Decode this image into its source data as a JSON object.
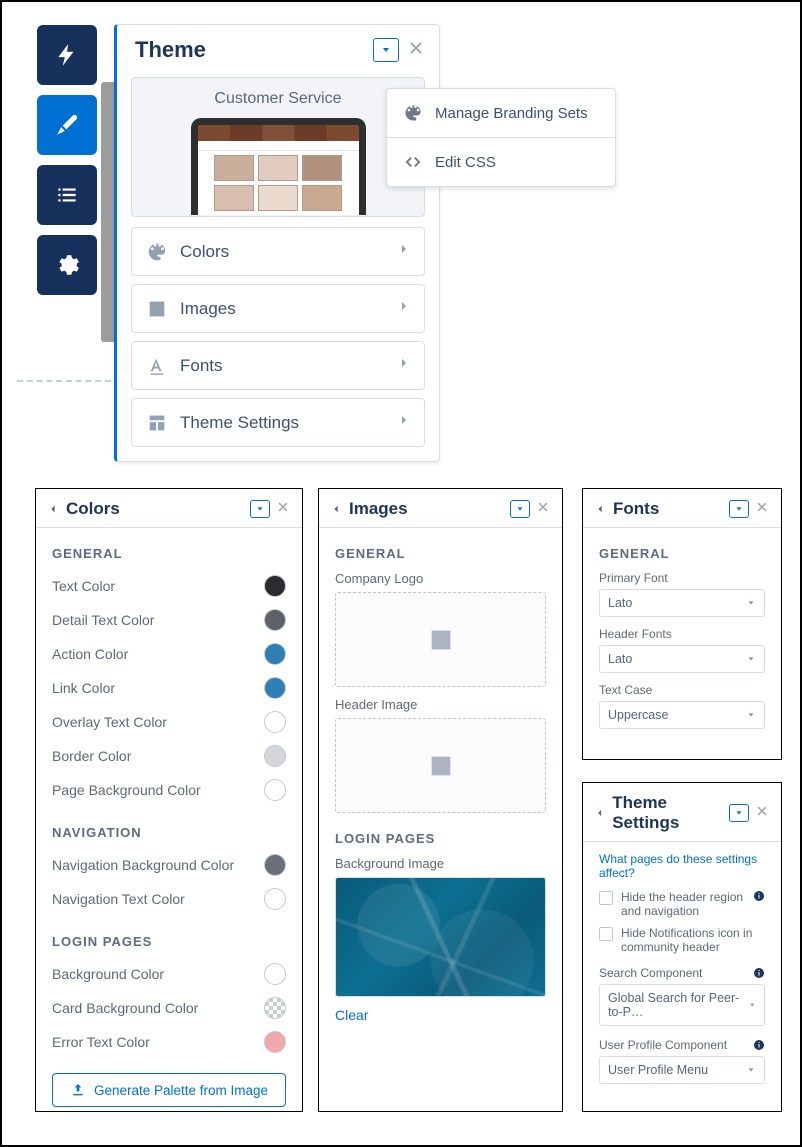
{
  "theme": {
    "title": "Theme",
    "previewTitle": "Customer Service",
    "items": [
      {
        "id": "colors",
        "label": "Colors"
      },
      {
        "id": "images",
        "label": "Images"
      },
      {
        "id": "fonts",
        "label": "Fonts"
      },
      {
        "id": "theme-settings",
        "label": "Theme Settings"
      }
    ],
    "popover": {
      "manage": "Manage Branding Sets",
      "editCss": "Edit CSS"
    }
  },
  "colorsPanel": {
    "title": "Colors",
    "sections": {
      "general": "GENERAL",
      "navigation": "NAVIGATION",
      "login": "LOGIN PAGES"
    },
    "rows": {
      "general": [
        {
          "label": "Text Color",
          "color": "#2b2b30"
        },
        {
          "label": "Detail Text Color",
          "color": "#5d6168"
        },
        {
          "label": "Action Color",
          "color": "#2f7fb4"
        },
        {
          "label": "Link Color",
          "color": "#2f7fb4"
        },
        {
          "label": "Overlay Text Color",
          "color": "#ffffff"
        },
        {
          "label": "Border Color",
          "color": "#d4d6dc"
        },
        {
          "label": "Page Background Color",
          "color": "#ffffff"
        }
      ],
      "navigation": [
        {
          "label": "Navigation Background Color",
          "color": "#6c7179"
        },
        {
          "label": "Navigation Text Color",
          "color": "#ffffff"
        }
      ],
      "login": [
        {
          "label": "Background Color",
          "color": "#ffffff"
        },
        {
          "label": "Card Background Color",
          "checker": true
        },
        {
          "label": "Error Text Color",
          "color": "#f2a8a8"
        }
      ]
    },
    "generate": "Generate Palette from Image"
  },
  "imagesPanel": {
    "title": "Images",
    "sections": {
      "general": "GENERAL",
      "login": "LOGIN PAGES"
    },
    "labels": {
      "logo": "Company Logo",
      "header": "Header Image",
      "bg": "Background Image"
    },
    "clear": "Clear"
  },
  "fontsPanel": {
    "title": "Fonts",
    "section": "GENERAL",
    "fields": [
      {
        "label": "Primary Font",
        "value": "Lato"
      },
      {
        "label": "Header Fonts",
        "value": "Lato"
      },
      {
        "label": "Text Case",
        "value": "Uppercase"
      }
    ]
  },
  "settingsPanel": {
    "title": "Theme Settings",
    "question": "What pages do these settings affect?",
    "checks": [
      "Hide the header region and navigation",
      "Hide Notifications icon in community header"
    ],
    "searchLabel": "Search Component",
    "searchValue": "Global Search for Peer-to-P…",
    "userLabel": "User Profile Component",
    "userValue": "User Profile Menu"
  }
}
